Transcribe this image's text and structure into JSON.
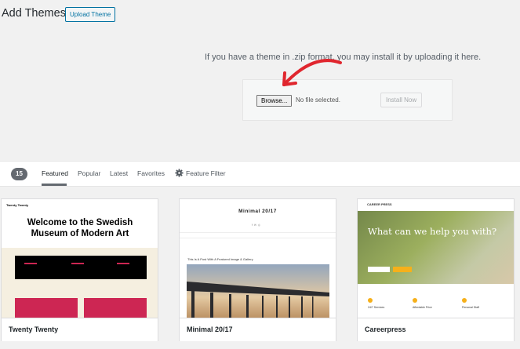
{
  "header": {
    "title": "Add Themes",
    "upload_label": "Upload Theme"
  },
  "uploader": {
    "help_text": "If you have a theme in .zip format, you may install it by uploading it here.",
    "browse_label": "Browse...",
    "file_status": "No file selected.",
    "install_label": "Install Now"
  },
  "filter": {
    "count": "15",
    "tabs": [
      "Featured",
      "Popular",
      "Latest",
      "Favorites"
    ],
    "feature_filter": "Feature Filter"
  },
  "themes": [
    {
      "name": "Twenty Twenty",
      "preview": {
        "brand": "Twenty Twenty",
        "headline": "Welcome to the Swedish Museum of Modern Art"
      }
    },
    {
      "name": "Minimal 20/17",
      "preview": {
        "title": "Minimal 20/17",
        "post_title": "This Is A Post With A Featured Image & Gallery"
      }
    },
    {
      "name": "Careerpress",
      "preview": {
        "logo": "CAREER PRESS",
        "headline": "What can we help you with?",
        "features": [
          "24/7 Services",
          "Affordable Price",
          "Personal Staff"
        ]
      }
    }
  ],
  "colors": {
    "wp_blue": "#0071a1",
    "annotation_arrow": "#e0262e",
    "tt_accent": "#cd2653",
    "cp_accent": "#f6b01a"
  }
}
